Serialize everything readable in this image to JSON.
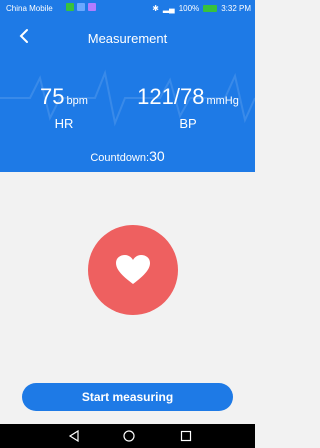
{
  "status_bar": {
    "carrier": "China Mobile",
    "battery": "100%",
    "time": "3:32 PM"
  },
  "header": {
    "title": "Measurement"
  },
  "metrics": {
    "hr": {
      "value": "75",
      "unit": "bpm",
      "label": "HR"
    },
    "bp": {
      "value": "121/78",
      "unit": "mmHg",
      "label": "BP"
    }
  },
  "countdown": {
    "label": "Countdown:",
    "value": "30"
  },
  "actions": {
    "start_label": "Start measuring"
  },
  "colors": {
    "primary": "#1e7ae6",
    "heart_button": "#ee6060",
    "background": "#f2f2f2"
  },
  "icons": {
    "back": "chevron-left-icon",
    "heart": "heart-icon",
    "nav_back": "triangle-back-icon",
    "nav_home": "circle-home-icon",
    "nav_recent": "square-recent-icon"
  }
}
